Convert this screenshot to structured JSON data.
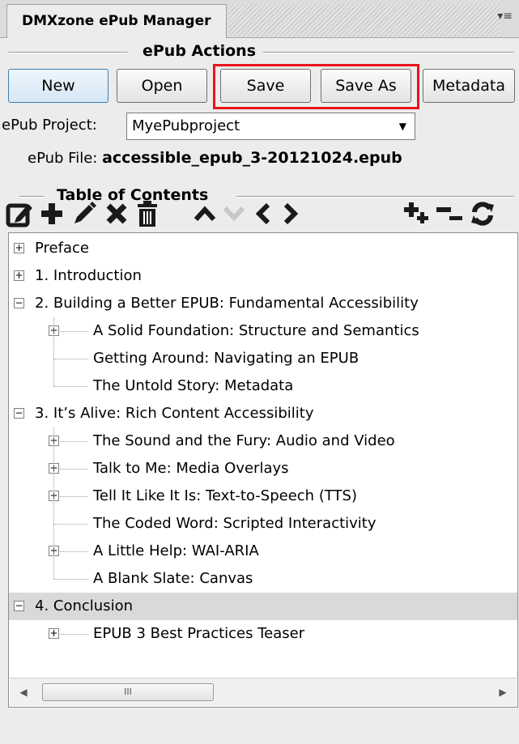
{
  "panel": {
    "title": "DMXzone ePub Manager",
    "menu_icon": "panel-menu-icon"
  },
  "actions": {
    "heading": "ePub Actions",
    "buttons": [
      "New",
      "Open",
      "Save",
      "Save As",
      "Metadata"
    ]
  },
  "project": {
    "label": "ePub Project:",
    "value": "MyePubproject"
  },
  "file": {
    "label": "ePub File:",
    "value": "accessible_epub_3-20121024.epub"
  },
  "toc": {
    "heading": "Table of Contents",
    "toolbar_icons": [
      "edit-icon",
      "add-icon",
      "pencil-icon",
      "delete-icon",
      "trash-icon",
      "move-up-icon",
      "move-down-icon",
      "outdent-icon",
      "indent-icon",
      "expand-all-icon",
      "collapse-all-icon",
      "refresh-icon"
    ],
    "items": [
      {
        "label": "Preface",
        "level": 0,
        "expander": "+"
      },
      {
        "label": "1. Introduction",
        "level": 0,
        "expander": "+"
      },
      {
        "label": "2. Building a Better EPUB: Fundamental Accessibility",
        "level": 0,
        "expander": "−"
      },
      {
        "label": "A Solid Foundation: Structure and Semantics",
        "level": 1,
        "expander": "+"
      },
      {
        "label": "Getting Around: Navigating an EPUB",
        "level": 1,
        "expander": ""
      },
      {
        "label": "The Untold Story: Metadata",
        "level": 1,
        "expander": ""
      },
      {
        "label": "3. It’s Alive: Rich Content Accessibility",
        "level": 0,
        "expander": "−"
      },
      {
        "label": "The Sound and the Fury: Audio and Video",
        "level": 1,
        "expander": "+"
      },
      {
        "label": "Talk to Me: Media Overlays",
        "level": 1,
        "expander": "+"
      },
      {
        "label": "Tell It Like It Is: Text-to-Speech (TTS)",
        "level": 1,
        "expander": "+"
      },
      {
        "label": "The Coded Word: Scripted Interactivity",
        "level": 1,
        "expander": ""
      },
      {
        "label": "A Little Help: WAI-ARIA",
        "level": 1,
        "expander": "+"
      },
      {
        "label": "A Blank Slate: Canvas",
        "level": 1,
        "expander": ""
      },
      {
        "label": "4. Conclusion",
        "level": 0,
        "expander": "−",
        "selected": true
      },
      {
        "label": "EPUB 3 Best Practices Teaser",
        "level": 1,
        "expander": "+"
      }
    ]
  },
  "scrollbar": {
    "thumb_grip": "III"
  },
  "colors": {
    "highlight": "#e8151b",
    "selected_row": "#d9d9d9",
    "icon": "#1a1a1a",
    "icon_disabled": "#c8c8c8"
  }
}
